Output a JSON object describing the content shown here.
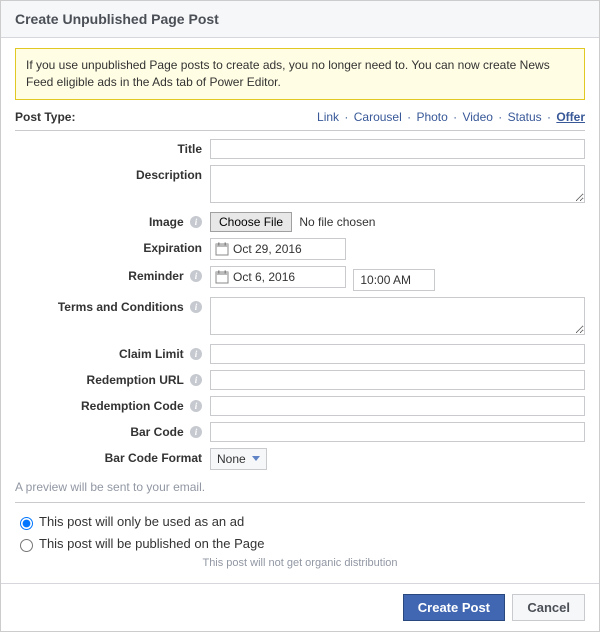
{
  "header": {
    "title": "Create Unpublished Page Post"
  },
  "notice": "If you use unpublished Page posts to create ads, you no longer need to. You can now create News Feed eligible ads in the Ads tab of Power Editor.",
  "postType": {
    "label": "Post Type:",
    "tabs": [
      "Link",
      "Carousel",
      "Photo",
      "Video",
      "Status",
      "Offer"
    ],
    "active": "Offer"
  },
  "form": {
    "title": {
      "label": "Title",
      "value": ""
    },
    "description": {
      "label": "Description",
      "value": ""
    },
    "image": {
      "label": "Image",
      "buttonLabel": "Choose File",
      "status": "No file chosen"
    },
    "expiration": {
      "label": "Expiration",
      "value": "Oct 29, 2016"
    },
    "reminder": {
      "label": "Reminder",
      "dateValue": "Oct 6, 2016",
      "timeValue": "10:00 AM"
    },
    "terms": {
      "label": "Terms and Conditions",
      "value": ""
    },
    "claimLimit": {
      "label": "Claim Limit",
      "value": ""
    },
    "redemptionUrl": {
      "label": "Redemption URL",
      "value": ""
    },
    "redemptionCode": {
      "label": "Redemption Code",
      "value": ""
    },
    "barCode": {
      "label": "Bar Code",
      "value": ""
    },
    "barCodeFormat": {
      "label": "Bar Code Format",
      "selected": "None"
    }
  },
  "previewNote": "A preview will be sent to your email.",
  "distribution": {
    "options": [
      "This post will only be used as an ad",
      "This post will be published on the Page"
    ],
    "selectedIndex": 0,
    "subNote": "This post will not get organic distribution"
  },
  "footer": {
    "primary": "Create Post",
    "secondary": "Cancel"
  }
}
